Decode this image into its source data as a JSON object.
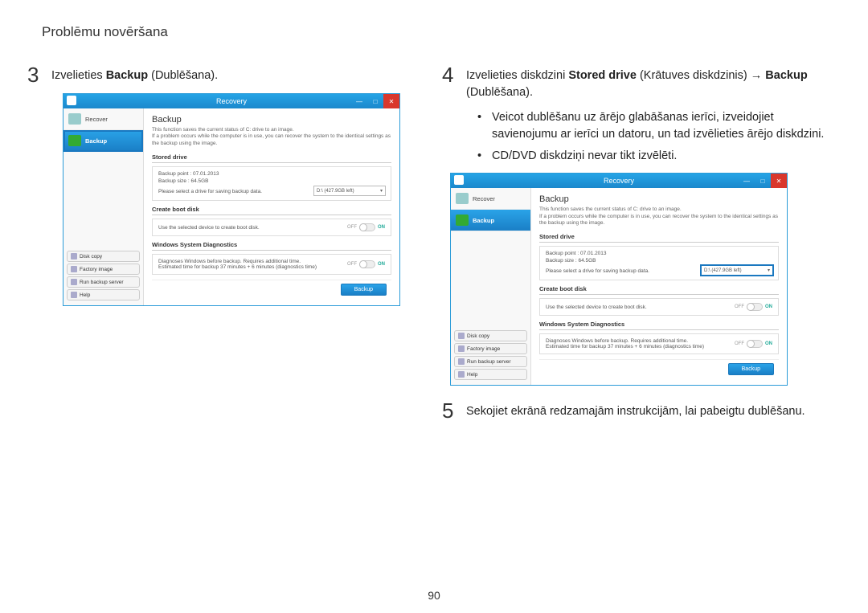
{
  "header": {
    "title": "Problēmu novēršana"
  },
  "page_number": "90",
  "step3": {
    "num": "3",
    "pre": "Izvelieties ",
    "bold": "Backup",
    "post": " (Dublēšana)."
  },
  "step4": {
    "num": "4",
    "pre": "Izvelieties diskdzini ",
    "bold": "Stored drive",
    "mid": " (Krātuves diskdzinis) → ",
    "bold2": "Backup",
    "post": " (Dublēšana).",
    "bullet1": "Veicot dublēšanu uz ārējo glabāšanas ierīci, izveidojiet savienojumu ar ierīci un datoru, un tad izvēlieties ārējo diskdzini.",
    "bullet2": "CD/DVD diskdziņi nevar tikt izvēlēti."
  },
  "step5": {
    "num": "5",
    "text": "Sekojiet ekrānā redzamajām instrukcijām, lai pabeigtu dublēšanu."
  },
  "app": {
    "title": "Recovery",
    "sidebar": {
      "recover": "Recover",
      "backup": "Backup",
      "disk_copy": "Disk copy",
      "factory_image": "Factory image",
      "run_backup_server": "Run backup server",
      "help": "Help"
    },
    "content": {
      "title": "Backup",
      "desc1": "This function saves the current status of C: drive to an image.",
      "desc2": "If a problem occurs while the computer is in use, you can recover the system to the identical settings as the backup using the image.",
      "stored_drive": "Stored drive",
      "backup_point": "Backup point : 07.01.2013",
      "backup_size": "Backup size : 64.5GB",
      "select_drive_msg": "Please select a drive for saving backup data.",
      "drive_value": "D:\\ (427.9GB left)",
      "create_boot_disk": "Create boot disk",
      "boot_msg": "Use the selected device to create boot disk.",
      "diagnostics": "Windows System Diagnostics",
      "diag_msg1": "Diagnoses Windows before backup. Requires additional time.",
      "diag_msg2": "Estimated time for backup 37 minutes + 6 minutes (diagnostics time)",
      "off": "OFF",
      "on": "ON",
      "backup_btn": "Backup"
    }
  }
}
